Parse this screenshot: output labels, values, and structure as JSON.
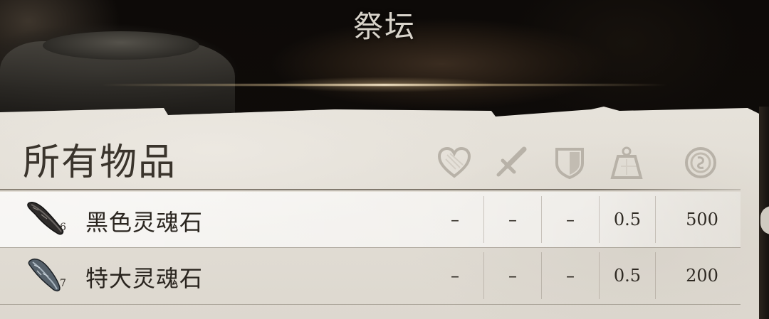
{
  "screen": {
    "title": "祭坛"
  },
  "inventory": {
    "heading": "所有物品",
    "columns": [
      {
        "icon": "heart-icon"
      },
      {
        "icon": "sword-icon"
      },
      {
        "icon": "shield-icon"
      },
      {
        "icon": "weight-icon"
      },
      {
        "icon": "coin-icon"
      }
    ],
    "items": [
      {
        "name": "黑色灵魂石",
        "count": "6",
        "icon": "black-soul-gem-icon",
        "heal": "–",
        "damage": "–",
        "armor": "–",
        "weight": "0.5",
        "value": "500",
        "selected": true
      },
      {
        "name": "特大灵魂石",
        "count": "7",
        "icon": "grand-soul-gem-icon",
        "heal": "–",
        "damage": "–",
        "armor": "–",
        "weight": "0.5",
        "value": "200",
        "selected": false
      }
    ]
  },
  "colors": {
    "parchment": "#e6e2da",
    "ink": "#2a251f",
    "title": "#d9d4cb"
  }
}
